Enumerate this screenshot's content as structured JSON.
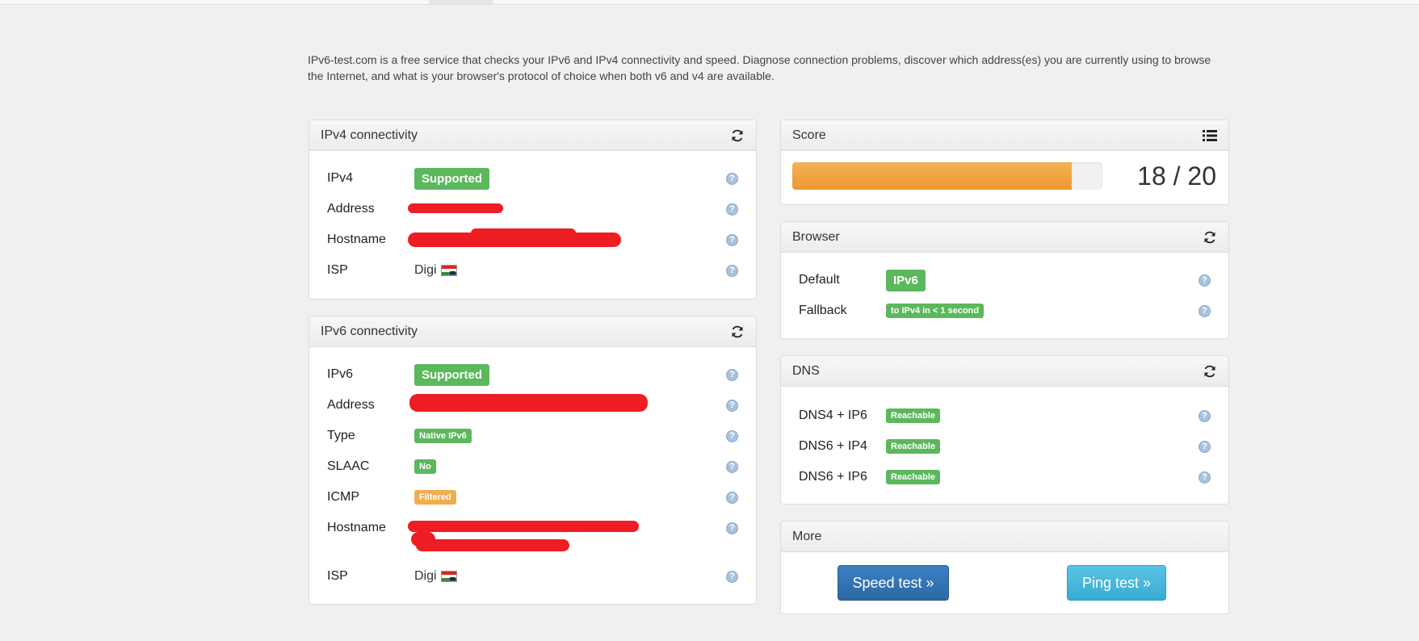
{
  "intro_text": "IPv6-test.com is a free service that checks your IPv6 and IPv4 connectivity and speed. Diagnose connection problems, discover which address(es) you are currently using to browse the Internet, and what is your browser's protocol of choice when both v6 and v4 are available.",
  "ipv4": {
    "title": "IPv4 connectivity",
    "rows": {
      "ipv4_label": "IPv4",
      "ipv4_value": "Supported",
      "address_label": "Address",
      "hostname_label": "Hostname",
      "isp_label": "ISP",
      "isp_value": "Digi"
    }
  },
  "ipv6": {
    "title": "IPv6 connectivity",
    "rows": {
      "ipv6_label": "IPv6",
      "ipv6_value": "Supported",
      "address_label": "Address",
      "type_label": "Type",
      "type_value": "Native IPv6",
      "slaac_label": "SLAAC",
      "slaac_value": "No",
      "icmp_label": "ICMP",
      "icmp_value": "Filtered",
      "hostname_label": "Hostname",
      "isp_label": "ISP",
      "isp_value": "Digi"
    }
  },
  "score": {
    "title": "Score",
    "text": "18 / 20",
    "fraction": 0.9
  },
  "browser": {
    "title": "Browser",
    "default_label": "Default",
    "default_value": "IPv6",
    "fallback_label": "Fallback",
    "fallback_value": "to IPv4 in < 1 second"
  },
  "dns": {
    "title": "DNS",
    "rows": [
      {
        "label": "DNS4 + IP6",
        "value": "Reachable"
      },
      {
        "label": "DNS6 + IP4",
        "value": "Reachable"
      },
      {
        "label": "DNS6 + IP6",
        "value": "Reachable"
      }
    ]
  },
  "more": {
    "title": "More",
    "speed_test": "Speed test »",
    "ping_test": "Ping test »"
  },
  "colors": {
    "success": "#5cb85c",
    "warning": "#f0ad4e",
    "primary": "#337ab7",
    "info": "#5bc0de",
    "redaction": "#ee1d23"
  },
  "icons": {
    "refresh": "refresh-icon",
    "list": "list-icon",
    "help": "help-icon",
    "flag": "hungary-flag-icon"
  }
}
